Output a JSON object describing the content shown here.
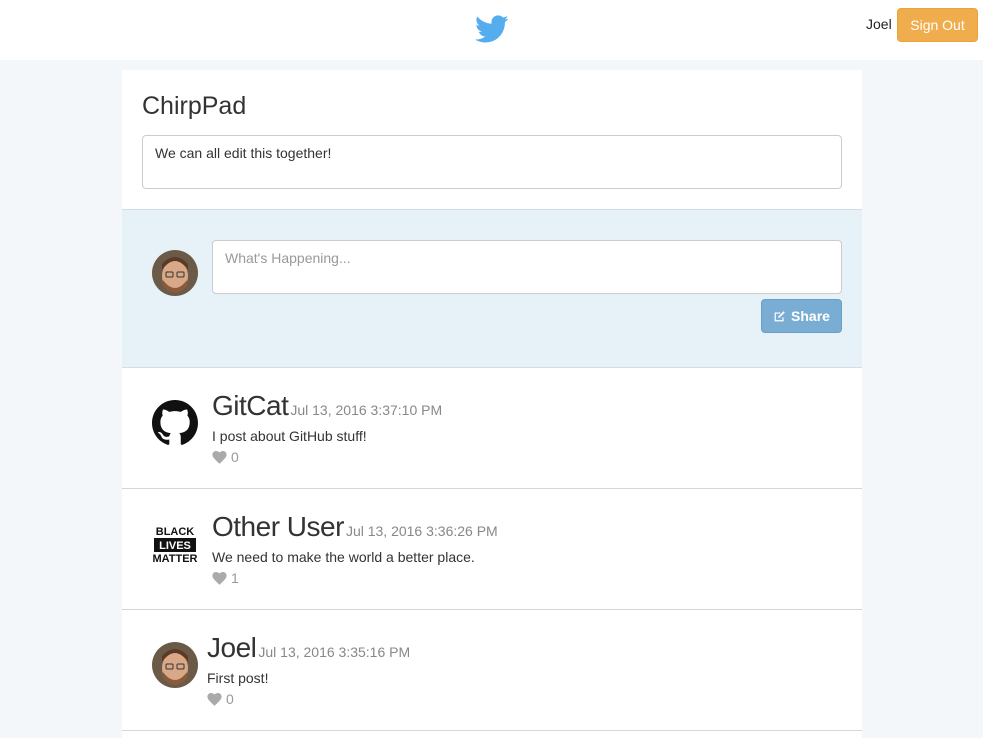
{
  "header": {
    "logo_icon": "bird-icon",
    "user_name": "Joel",
    "signout_label": "Sign Out"
  },
  "pad": {
    "title": "ChirpPad",
    "text": "We can all edit this together!"
  },
  "compose": {
    "placeholder": "What's Happening...",
    "share_label": "Share",
    "share_icon": "edit-icon"
  },
  "chirps": [
    {
      "user": "GitCat",
      "time": "Jul 13, 2016 3:37:10 PM",
      "text": "I post about GitHub stuff!",
      "likes": "0",
      "avatar": "github-octocat-icon"
    },
    {
      "user": "Other User",
      "time": "Jul 13, 2016 3:36:26 PM",
      "text": "We need to make the world a better place.",
      "likes": "1",
      "avatar": "black-lives-matter-logo"
    },
    {
      "user": "Joel",
      "time": "Jul 13, 2016 3:35:16 PM",
      "text": "First post!",
      "likes": "0",
      "avatar": "user-photo"
    }
  ],
  "colors": {
    "accent_orange": "#f0ad4e",
    "share_blue": "#7aadd4",
    "compose_bg": "#e6f1f8",
    "twitter_blue": "#55acee"
  }
}
